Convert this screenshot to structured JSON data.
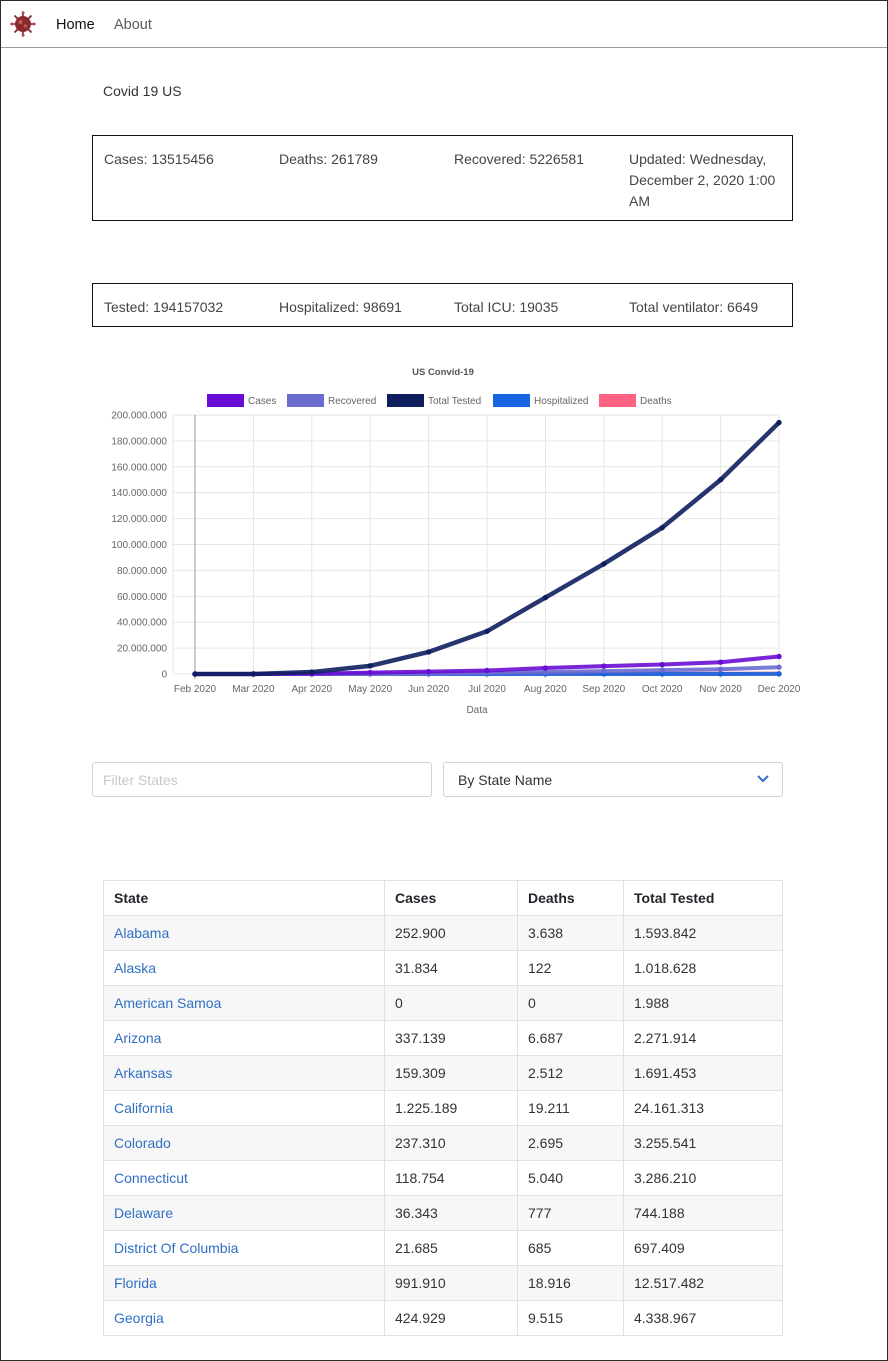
{
  "nav": {
    "logo_icon": "virus-icon",
    "home": "Home",
    "about": "About"
  },
  "page_title": "Covid 19 US",
  "summary": {
    "cases": "Cases: 13515456",
    "deaths": "Deaths: 261789",
    "recovered": "Recovered: 5226581",
    "updated_line1": "Updated: Wednesday,",
    "updated_line2": "December 2, 2020 1:00",
    "updated_line3": "AM"
  },
  "summary2": {
    "tested": "Tested: 194157032",
    "hospitalized": "Hospitalized: 98691",
    "icu": "Total ICU: 19035",
    "ventilator": "Total ventilator: 6649"
  },
  "chart_data": {
    "type": "line",
    "title": "US Convid-19",
    "xlabel": "Data",
    "ylabel": "",
    "categories": [
      "Feb 2020",
      "Mar 2020",
      "Apr 2020",
      "May 2020",
      "Jun 2020",
      "Jul 2020",
      "Aug 2020",
      "Sep 2020",
      "Oct 2020",
      "Nov 2020",
      "Dec 2020"
    ],
    "yticks": [
      "200.000.000",
      "180.000.000",
      "160.000.000",
      "140.000.000",
      "120.000.000",
      "100.000.000",
      "80.000.000",
      "60.000.000",
      "40.000.000",
      "20.000.000",
      "0"
    ],
    "ylim": [
      0,
      200000000
    ],
    "legend_position": "top",
    "grid": true,
    "series": [
      {
        "name": "Cases",
        "color": "#6a0dd4",
        "values": [
          0,
          100,
          200000,
          1100000,
          1800000,
          2700000,
          4600000,
          6100000,
          7300000,
          9100000,
          13515456
        ]
      },
      {
        "name": "Recovered",
        "color": "#6b6ccf",
        "values": [
          0,
          0,
          20000,
          150000,
          400000,
          800000,
          1400000,
          2200000,
          3000000,
          3700000,
          5226581
        ]
      },
      {
        "name": "Total Tested",
        "color": "#0f1f5e",
        "values": [
          0,
          1000,
          1500000,
          6300000,
          17000000,
          33000000,
          59000000,
          85000000,
          113000000,
          150000000,
          194157032
        ]
      },
      {
        "name": "Hospitalized",
        "color": "#1565e0",
        "values": [
          0,
          0,
          10000,
          60000,
          45000,
          35000,
          55000,
          40000,
          30000,
          40000,
          98691
        ]
      },
      {
        "name": "Deaths",
        "color": "#ff6384",
        "values": [
          0,
          0,
          2000,
          60000,
          105000,
          128000,
          155000,
          185000,
          208000,
          232000,
          261789
        ]
      }
    ]
  },
  "filter": {
    "placeholder": "Filter States",
    "sort_selected": "By State Name",
    "chevron_icon": "chevron-down-icon"
  },
  "table": {
    "headers": [
      "State",
      "Cases",
      "Deaths",
      "Total Tested"
    ],
    "rows": [
      [
        "Alabama",
        "252.900",
        "3.638",
        "1.593.842"
      ],
      [
        "Alaska",
        "31.834",
        "122",
        "1.018.628"
      ],
      [
        "American Samoa",
        "0",
        "0",
        "1.988"
      ],
      [
        "Arizona",
        "337.139",
        "6.687",
        "2.271.914"
      ],
      [
        "Arkansas",
        "159.309",
        "2.512",
        "1.691.453"
      ],
      [
        "California",
        "1.225.189",
        "19.211",
        "24.161.313"
      ],
      [
        "Colorado",
        "237.310",
        "2.695",
        "3.255.541"
      ],
      [
        "Connecticut",
        "118.754",
        "5.040",
        "3.286.210"
      ],
      [
        "Delaware",
        "36.343",
        "777",
        "744.188"
      ],
      [
        "District Of Columbia",
        "21.685",
        "685",
        "697.409"
      ],
      [
        "Florida",
        "991.910",
        "18.916",
        "12.517.482"
      ],
      [
        "Georgia",
        "424.929",
        "9.515",
        "4.338.967"
      ]
    ]
  }
}
